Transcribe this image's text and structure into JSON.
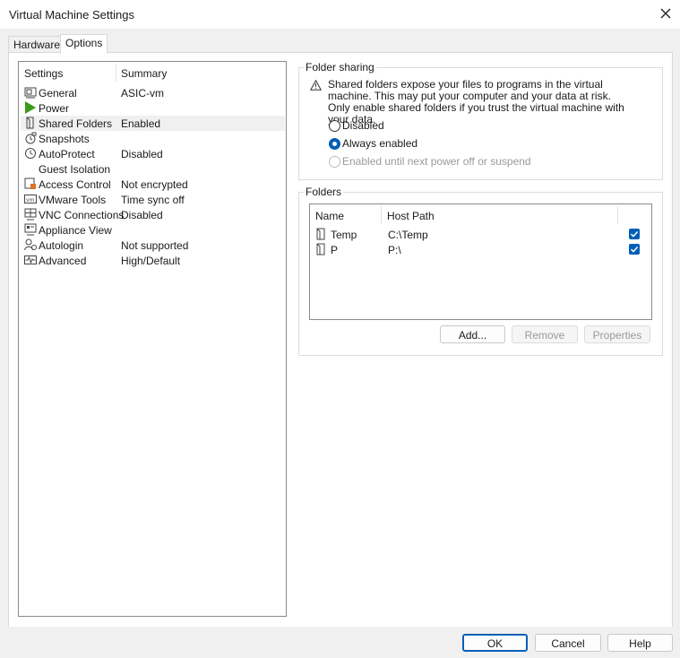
{
  "window": {
    "title": "Virtual Machine Settings"
  },
  "tabs": [
    {
      "label": "Hardware"
    },
    {
      "label": "Options"
    }
  ],
  "settings": {
    "header_settings": "Settings",
    "header_summary": "Summary",
    "items": [
      {
        "name": "General",
        "summary": "ASIC-vm",
        "icon": "general-icon"
      },
      {
        "name": "Power",
        "summary": "",
        "icon": "power-icon"
      },
      {
        "name": "Shared Folders",
        "summary": "Enabled",
        "icon": "shared-folders-icon"
      },
      {
        "name": "Snapshots",
        "summary": "",
        "icon": "snapshots-icon"
      },
      {
        "name": "AutoProtect",
        "summary": "Disabled",
        "icon": "autoprotect-icon"
      },
      {
        "name": "Guest Isolation",
        "summary": "",
        "icon": "guest-isolation-icon"
      },
      {
        "name": "Access Control",
        "summary": "Not encrypted",
        "icon": "access-control-icon"
      },
      {
        "name": "VMware Tools",
        "summary": "Time sync off",
        "icon": "vmware-tools-icon"
      },
      {
        "name": "VNC Connections",
        "summary": "Disabled",
        "icon": "vnc-connections-icon"
      },
      {
        "name": "Appliance View",
        "summary": "",
        "icon": "appliance-view-icon"
      },
      {
        "name": "Autologin",
        "summary": "Not supported",
        "icon": "autologin-icon"
      },
      {
        "name": "Advanced",
        "summary": "High/Default",
        "icon": "advanced-icon"
      }
    ]
  },
  "folder_sharing": {
    "title": "Folder sharing",
    "warning": "Shared folders expose your files to programs in the virtual machine. This may put your computer and your data at risk. Only enable shared folders if you trust the virtual machine with your data.",
    "options": [
      {
        "label": "Disabled",
        "selected": false,
        "disabled": false
      },
      {
        "label": "Always enabled",
        "selected": true,
        "disabled": false
      },
      {
        "label": "Enabled until next power off or suspend",
        "selected": false,
        "disabled": true
      }
    ]
  },
  "folders": {
    "title": "Folders",
    "col_name": "Name",
    "col_path": "Host Path",
    "rows": [
      {
        "name": "Temp",
        "path": "C:\\Temp",
        "checked": true
      },
      {
        "name": "P",
        "path": "P:\\",
        "checked": true
      }
    ],
    "add_label": "Add...",
    "remove_label": "Remove",
    "properties_label": "Properties"
  },
  "footer": {
    "ok": "OK",
    "cancel": "Cancel",
    "help": "Help"
  },
  "colors": {
    "accent": "#005fb8",
    "power_green": "#3a9a1e"
  }
}
